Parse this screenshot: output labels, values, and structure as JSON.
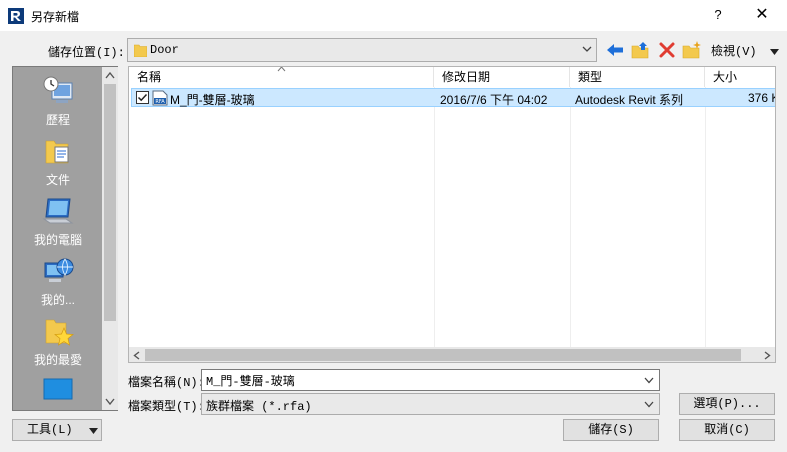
{
  "window": {
    "title": "另存新檔",
    "help_glyph": "?",
    "close_glyph": "✕"
  },
  "location": {
    "label": "儲存位置(I):",
    "value": "Door"
  },
  "toolbar": {
    "views_label": "檢視(V)"
  },
  "places": [
    {
      "label": "歷程",
      "icon": "history-icon"
    },
    {
      "label": "文件",
      "icon": "documents-icon"
    },
    {
      "label": "我的電腦",
      "icon": "computer-icon"
    },
    {
      "label": "我的...",
      "icon": "network-icon"
    },
    {
      "label": "我的最愛",
      "icon": "favorites-icon"
    }
  ],
  "file_list": {
    "columns": [
      "名稱",
      "修改日期",
      "類型",
      "大小"
    ],
    "rows": [
      {
        "name": "M_門-雙層-玻璃",
        "modified": "2016/7/6 下午 04:02",
        "type": "Autodesk Revit 系列",
        "size": "376 K",
        "checked": true
      }
    ]
  },
  "filename": {
    "label": "檔案名稱(N):",
    "value": "M_門-雙層-玻璃"
  },
  "filetype": {
    "label": "檔案類型(T):",
    "value": "族群檔案  (*.rfa)"
  },
  "buttons": {
    "options": "選項(P)...",
    "tools": "工具(L)",
    "save": "儲存(S)",
    "cancel": "取消(C)"
  },
  "colors": {
    "places_bg": "#a0a0a0",
    "selection": "#cce8ff",
    "nav_arrow": "#1e6fd9",
    "delete_x": "#e03c31",
    "folder": "#f3c94d"
  }
}
